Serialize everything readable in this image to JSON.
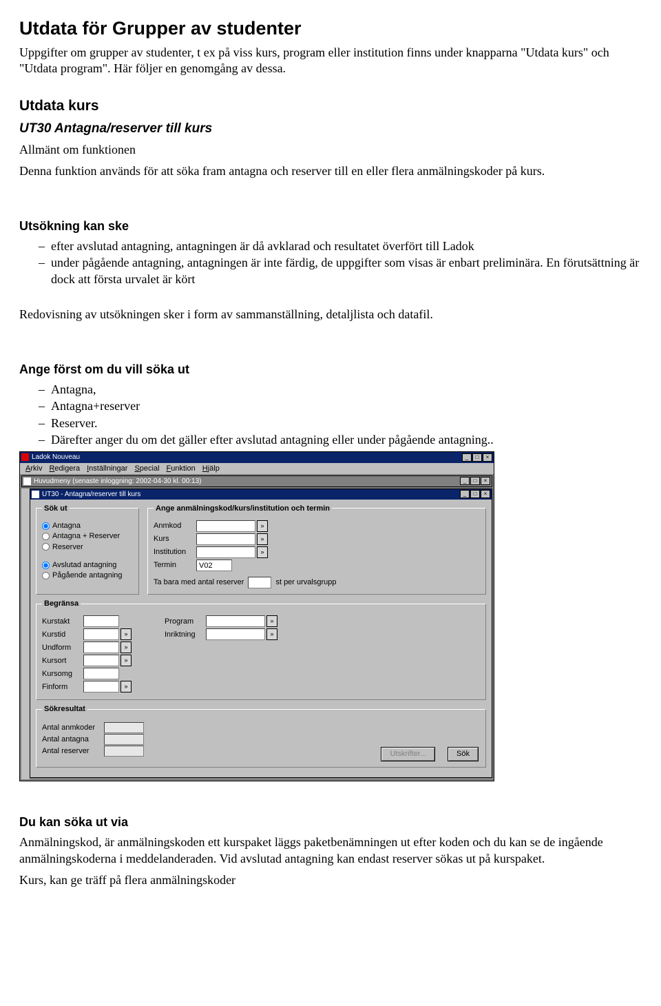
{
  "doc": {
    "title": "Utdata för Grupper av studenter",
    "intro": "Uppgifter om grupper av studenter, t ex på viss kurs, program eller institution finns under knapparna \"Utdata kurs\" och \"Utdata program\". Här följer en genomgång av dessa.",
    "utdata_kurs_heading": "Utdata kurs",
    "ut30_heading": "UT30 Antagna/reserver till kurs",
    "allmant_label": "Allmänt om funktionen",
    "allmant_body": "Denna funktion används för att söka fram antagna och reserver till en eller flera anmälningskoder på kurs.",
    "utsokning_heading": "Utsökning kan ske",
    "utsokning_items": [
      "efter avslutad antagning, antagningen är då avklarad och resultatet överfört till Ladok",
      "under pågående antagning, antagningen är inte färdig, de uppgifter som visas är enbart preliminära. En förutsättning är dock att första urvalet är kört"
    ],
    "redovisning": "Redovisning av utsökningen sker i form av sammanställning, detaljlista och datafil.",
    "ange_heading": "Ange först om du vill söka ut",
    "ange_items": [
      "Antagna,",
      "Antagna+reserver",
      "Reserver.",
      "Därefter anger du om det gäller efter avslutad antagning eller under pågående antagning.."
    ],
    "dukan_heading": "Du kan söka ut via",
    "dukan_body": "Anmälningskod, är anmälningskoden ett kurspaket läggs paketbenämningen ut efter koden och du kan se de ingående anmälningskoderna i meddelanderaden. Vid avslutad antagning kan endast reserver sökas ut på kurspaket.",
    "dukan_body2": "Kurs, kan ge träff på flera anmälningskoder"
  },
  "app": {
    "app_title": "Ladok Nouveau",
    "menubar": {
      "arkiv": "Arkiv",
      "redigera": "Redigera",
      "installningar": "Inställningar",
      "special": "Special",
      "funktion": "Funktion",
      "hjalp": "Hjälp"
    },
    "huvudmeny_title": "Huvudmeny   (senaste inloggning: 2002-04-30 kl. 00:13)",
    "ut30_title": "UT30 - Antagna/reserver till kurs",
    "sok_ut": {
      "legend": "Sök ut",
      "r_antagna": "Antagna",
      "r_antagna_reserver": "Antagna + Reserver",
      "r_reserver": "Reserver",
      "r_avslutad": "Avslutad antagning",
      "r_pagaende": "Pågående antagning"
    },
    "ange": {
      "legend": "Ange anmälningskod/kurs/institution och termin",
      "anmkod": "Anmkod",
      "kurs": "Kurs",
      "institution": "Institution",
      "termin": "Termin",
      "termin_val": "V02",
      "tabara": "Ta bara med antal reserver",
      "tabara_suffix": "st per urvalsgrupp"
    },
    "begransa": {
      "legend": "Begränsa",
      "kurstakt": "Kurstakt",
      "kurstid": "Kurstid",
      "undform": "Undform",
      "kursort": "Kursort",
      "kursomg": "Kursomg",
      "finform": "Finform",
      "program": "Program",
      "inriktning": "Inriktning"
    },
    "sokresultat": {
      "legend": "Sökresultat",
      "antal_anmkoder": "Antal anmkoder",
      "antal_antagna": "Antal antagna",
      "antal_reserver": "Antal reserver"
    },
    "buttons": {
      "utskrifter": "Utskrifter...",
      "sok": "Sök"
    }
  }
}
